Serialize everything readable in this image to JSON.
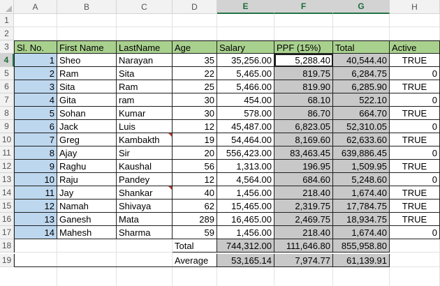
{
  "columns": [
    "A",
    "B",
    "C",
    "D",
    "E",
    "F",
    "G",
    "H"
  ],
  "rows": [
    "1",
    "2",
    "3",
    "4",
    "5",
    "6",
    "7",
    "8",
    "9",
    "10",
    "11",
    "12",
    "13",
    "14",
    "15",
    "16",
    "17",
    "18",
    "19"
  ],
  "headers": [
    "Sl. No.",
    "First Name",
    "LastName",
    "Age",
    "Salary",
    "PPF (15%)",
    "Total",
    "Active"
  ],
  "data": [
    [
      "1",
      "Sheo",
      "Narayan",
      "35",
      "35,256.00",
      "5,288.40",
      "40,544.40",
      "TRUE"
    ],
    [
      "2",
      "Ram",
      "Sita",
      "22",
      "5,465.00",
      "819.75",
      "6,284.75",
      "0"
    ],
    [
      "3",
      "Sita",
      "Ram",
      "25",
      "5,466.00",
      "819.90",
      "6,285.90",
      "TRUE"
    ],
    [
      "4",
      "Gita",
      "ram",
      "30",
      "454.00",
      "68.10",
      "522.10",
      "0"
    ],
    [
      "5",
      "Sohan",
      "Kumar",
      "30",
      "578.00",
      "86.70",
      "664.70",
      "TRUE"
    ],
    [
      "6",
      "Jack",
      "Luis",
      "12",
      "45,487.00",
      "6,823.05",
      "52,310.05",
      "0"
    ],
    [
      "7",
      "Greg",
      "Kambakth",
      "19",
      "54,464.00",
      "8,169.60",
      "62,633.60",
      "TRUE"
    ],
    [
      "8",
      "Ajay",
      "Sir",
      "20",
      "556,423.00",
      "83,463.45",
      "639,886.45",
      "0"
    ],
    [
      "9",
      "Raghu",
      "Kaushal",
      "56",
      "1,313.00",
      "196.95",
      "1,509.95",
      "TRUE"
    ],
    [
      "10",
      "Raju",
      "Pandey",
      "12",
      "4,564.00",
      "684.60",
      "5,248.60",
      "0"
    ],
    [
      "11",
      "Jay",
      "Shankar",
      "40",
      "1,456.00",
      "218.40",
      "1,674.40",
      "TRUE"
    ],
    [
      "12",
      "Namah",
      "Shivaya",
      "62",
      "15,465.00",
      "2,319.75",
      "17,784.75",
      "TRUE"
    ],
    [
      "13",
      "Ganesh",
      "Mata",
      "289",
      "16,465.00",
      "2,469.75",
      "18,934.75",
      "TRUE"
    ],
    [
      "14",
      "Mahesh",
      "Sharma",
      "59",
      "1,456.00",
      "218.40",
      "1,674.40",
      "0"
    ]
  ],
  "summary": [
    {
      "label": "Total",
      "salary": "744,312.00",
      "ppf": "111,646.80",
      "total": "855,958.80"
    },
    {
      "label": "Average",
      "salary": "53,165.14",
      "ppf": "7,974.77",
      "total": "61,139.91"
    }
  ],
  "colors": {
    "header_fill": "#a9d18e",
    "slno_fill": "#bdd7ee",
    "selection_fill": "#c8c8c8",
    "summary_fill": "#c8c8c8",
    "comment_marker": "#c0392b",
    "excel_green": "#217346"
  }
}
